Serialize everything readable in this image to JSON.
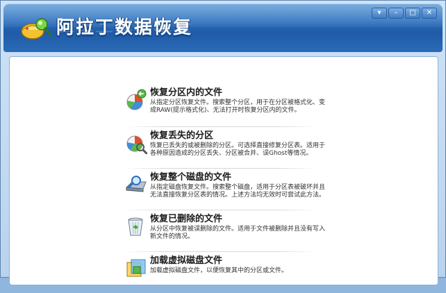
{
  "app": {
    "title": "阿拉丁数据恢复",
    "icon": "app-logo-icon"
  },
  "window_controls": [
    {
      "name": "dropdown",
      "glyph": "▾"
    },
    {
      "name": "minimize",
      "glyph": "–"
    },
    {
      "name": "maximize",
      "glyph": "□"
    },
    {
      "name": "close",
      "glyph": "✕"
    }
  ],
  "options": [
    {
      "title": "恢复分区内的文件",
      "desc": "从指定分区恢复文件。搜索整个分区，用于在分区被格式化、变成RAW(提示格式化)、无法打开时恢复分区内的文件。",
      "icon": "partition-files-icon"
    },
    {
      "title": "恢复丢失的分区",
      "desc": "恢复已丢失的或被删除的分区。可选择直接修复分区表。适用于各种原因造成的分区丢失、分区被合并、误Ghost等情况。",
      "icon": "lost-partition-icon"
    },
    {
      "title": "恢复整个磁盘的文件",
      "desc": "从指定磁盘恢复文件。搜索整个磁盘，适用于分区表被破坏并且无法直接恢复分区表的情况。上述方法均无效时可尝试此方法。",
      "icon": "disk-search-icon"
    },
    {
      "title": "恢复已删除的文件",
      "desc": "从分区中恢复被误删除的文件。适用于文件被删除并且没有写入新文件的情况。",
      "icon": "recycle-bin-icon"
    },
    {
      "title": "加载虚拟磁盘文件",
      "desc": "加载虚拟磁盘文件，以便恢复其中的分区或文件。",
      "icon": "virtual-disk-icon"
    }
  ],
  "colors": {
    "header": "#2f72bf",
    "frame": "#b9d3ee",
    "content_bg": "#ffffff"
  }
}
